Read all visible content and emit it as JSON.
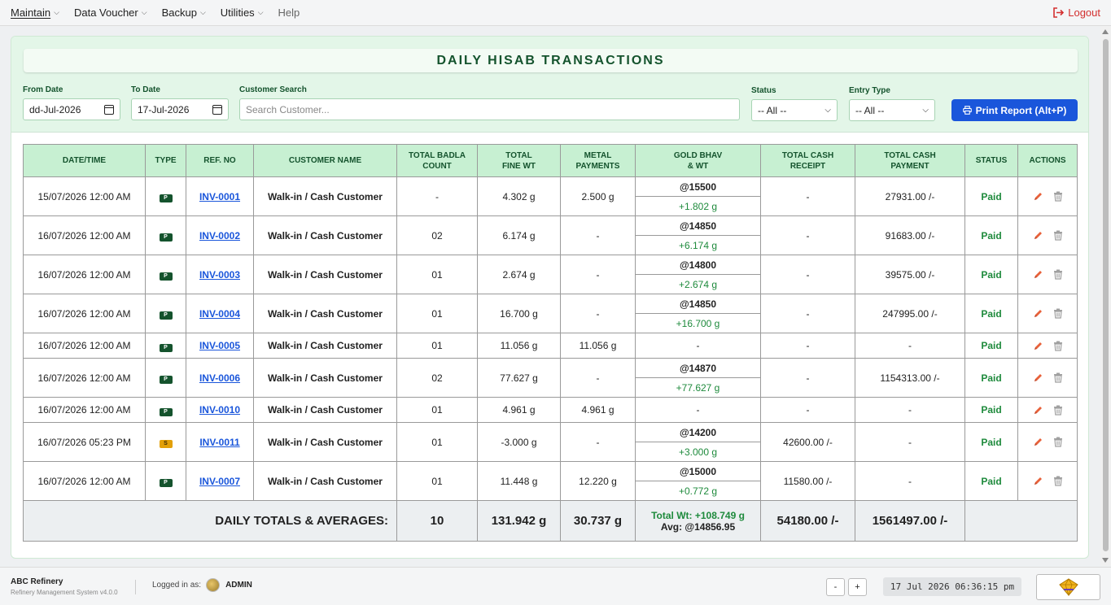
{
  "menu": {
    "items": [
      {
        "label": "Maintain"
      },
      {
        "label": "Data Voucher"
      },
      {
        "label": "Backup"
      },
      {
        "label": "Utilities"
      }
    ],
    "help": "Help",
    "logout": "Logout"
  },
  "page": {
    "title": "DAILY HISAB TRANSACTIONS"
  },
  "filters": {
    "from_date_label": "From Date",
    "from_date_value": "dd-Jul-2026",
    "to_date_label": "To Date",
    "to_date_value": "17-Jul-2026",
    "customer_label": "Customer Search",
    "customer_placeholder": "Search Customer...",
    "status_label": "Status",
    "status_value": "-- All --",
    "entry_type_label": "Entry Type",
    "entry_type_value": "-- All --",
    "print_button": "Print Report (Alt+P)"
  },
  "table": {
    "headers": {
      "datetime": "DATE/TIME",
      "type": "TYPE",
      "ref": "REF. NO",
      "customer": "CUSTOMER NAME",
      "badla_1": "TOTAL BADLA",
      "badla_2": "COUNT",
      "fine_1": "TOTAL",
      "fine_2": "FINE WT",
      "metal_1": "METAL",
      "metal_2": "PAYMENTS",
      "bhav_1": "GOLD BHAV",
      "bhav_2": "& WT",
      "receipt_1": "TOTAL CASH",
      "receipt_2": "RECEIPT",
      "payment_1": "TOTAL CASH",
      "payment_2": "PAYMENT",
      "status": "STATUS",
      "actions": "ACTIONS"
    },
    "rows": [
      {
        "datetime": "15/07/2026 12:00 AM",
        "type": "P",
        "ref": "INV-0001",
        "customer": "Walk-in / Cash Customer",
        "badla": "-",
        "fine": "4.302 g",
        "metal": "2.500 g",
        "bhav_rate": "@15500",
        "bhav_wt": "+1.802 g",
        "receipt": "-",
        "payment": "27931.00 /-",
        "status": "Paid"
      },
      {
        "datetime": "16/07/2026 12:00 AM",
        "type": "P",
        "ref": "INV-0002",
        "customer": "Walk-in / Cash Customer",
        "badla": "02",
        "fine": "6.174 g",
        "metal": "-",
        "bhav_rate": "@14850",
        "bhav_wt": "+6.174 g",
        "receipt": "-",
        "payment": "91683.00 /-",
        "status": "Paid"
      },
      {
        "datetime": "16/07/2026 12:00 AM",
        "type": "P",
        "ref": "INV-0003",
        "customer": "Walk-in / Cash Customer",
        "badla": "01",
        "fine": "2.674 g",
        "metal": "-",
        "bhav_rate": "@14800",
        "bhav_wt": "+2.674 g",
        "receipt": "-",
        "payment": "39575.00 /-",
        "status": "Paid"
      },
      {
        "datetime": "16/07/2026 12:00 AM",
        "type": "P",
        "ref": "INV-0004",
        "customer": "Walk-in / Cash Customer",
        "badla": "01",
        "fine": "16.700 g",
        "metal": "-",
        "bhav_rate": "@14850",
        "bhav_wt": "+16.700 g",
        "receipt": "-",
        "payment": "247995.00 /-",
        "status": "Paid"
      },
      {
        "datetime": "16/07/2026 12:00 AM",
        "type": "P",
        "ref": "INV-0005",
        "customer": "Walk-in / Cash Customer",
        "badla": "01",
        "fine": "11.056 g",
        "metal": "11.056 g",
        "bhav_single": "-",
        "receipt": "-",
        "payment": "-",
        "status": "Paid"
      },
      {
        "datetime": "16/07/2026 12:00 AM",
        "type": "P",
        "ref": "INV-0006",
        "customer": "Walk-in / Cash Customer",
        "badla": "02",
        "fine": "77.627 g",
        "metal": "-",
        "bhav_rate": "@14870",
        "bhav_wt": "+77.627 g",
        "receipt": "-",
        "payment": "1154313.00 /-",
        "status": "Paid"
      },
      {
        "datetime": "16/07/2026 12:00 AM",
        "type": "P",
        "ref": "INV-0010",
        "customer": "Walk-in / Cash Customer",
        "badla": "01",
        "fine": "4.961 g",
        "metal": "4.961 g",
        "bhav_single": "-",
        "receipt": "-",
        "payment": "-",
        "status": "Paid"
      },
      {
        "datetime": "16/07/2026 05:23 PM",
        "type": "S",
        "ref": "INV-0011",
        "customer": "Walk-in / Cash Customer",
        "badla": "01",
        "fine": "-3.000 g",
        "metal": "-",
        "bhav_rate": "@14200",
        "bhav_wt": "+3.000 g",
        "receipt": "42600.00 /-",
        "payment": "-",
        "status": "Paid"
      },
      {
        "datetime": "16/07/2026 12:00 AM",
        "type": "P",
        "ref": "INV-0007",
        "customer": "Walk-in / Cash Customer",
        "badla": "01",
        "fine": "11.448 g",
        "metal": "12.220 g",
        "bhav_rate": "@15000",
        "bhav_wt": "+0.772 g",
        "receipt": "11580.00 /-",
        "payment": "-",
        "status": "Paid"
      }
    ],
    "totals": {
      "label": "DAILY TOTALS & AVERAGES:",
      "badla": "10",
      "fine": "131.942 g",
      "metal": "30.737 g",
      "bhav_wt": "Total Wt: +108.749 g",
      "bhav_avg": "Avg: @14856.95",
      "receipt": "54180.00 /-",
      "payment": "1561497.00 /-"
    }
  },
  "footer": {
    "company": "ABC Refinery",
    "system": "Refinery Management System v4.0.0",
    "logged_label": "Logged in as:",
    "user": "ADMIN",
    "zoom_out": "-",
    "zoom_in": "+",
    "clock": "17 Jul 2026 06:36:15 pm"
  },
  "colors": {
    "accent": "#1a56db",
    "header_green": "#c7f0d2",
    "title_green": "#14532d",
    "paid": "#1e8a3c",
    "logout": "#d32f2f"
  },
  "icons": [
    "chevron-down-icon",
    "logout-icon",
    "calendar-icon",
    "printer-icon",
    "edit-icon",
    "trash-icon",
    "avatar",
    "app-logo-icon"
  ]
}
